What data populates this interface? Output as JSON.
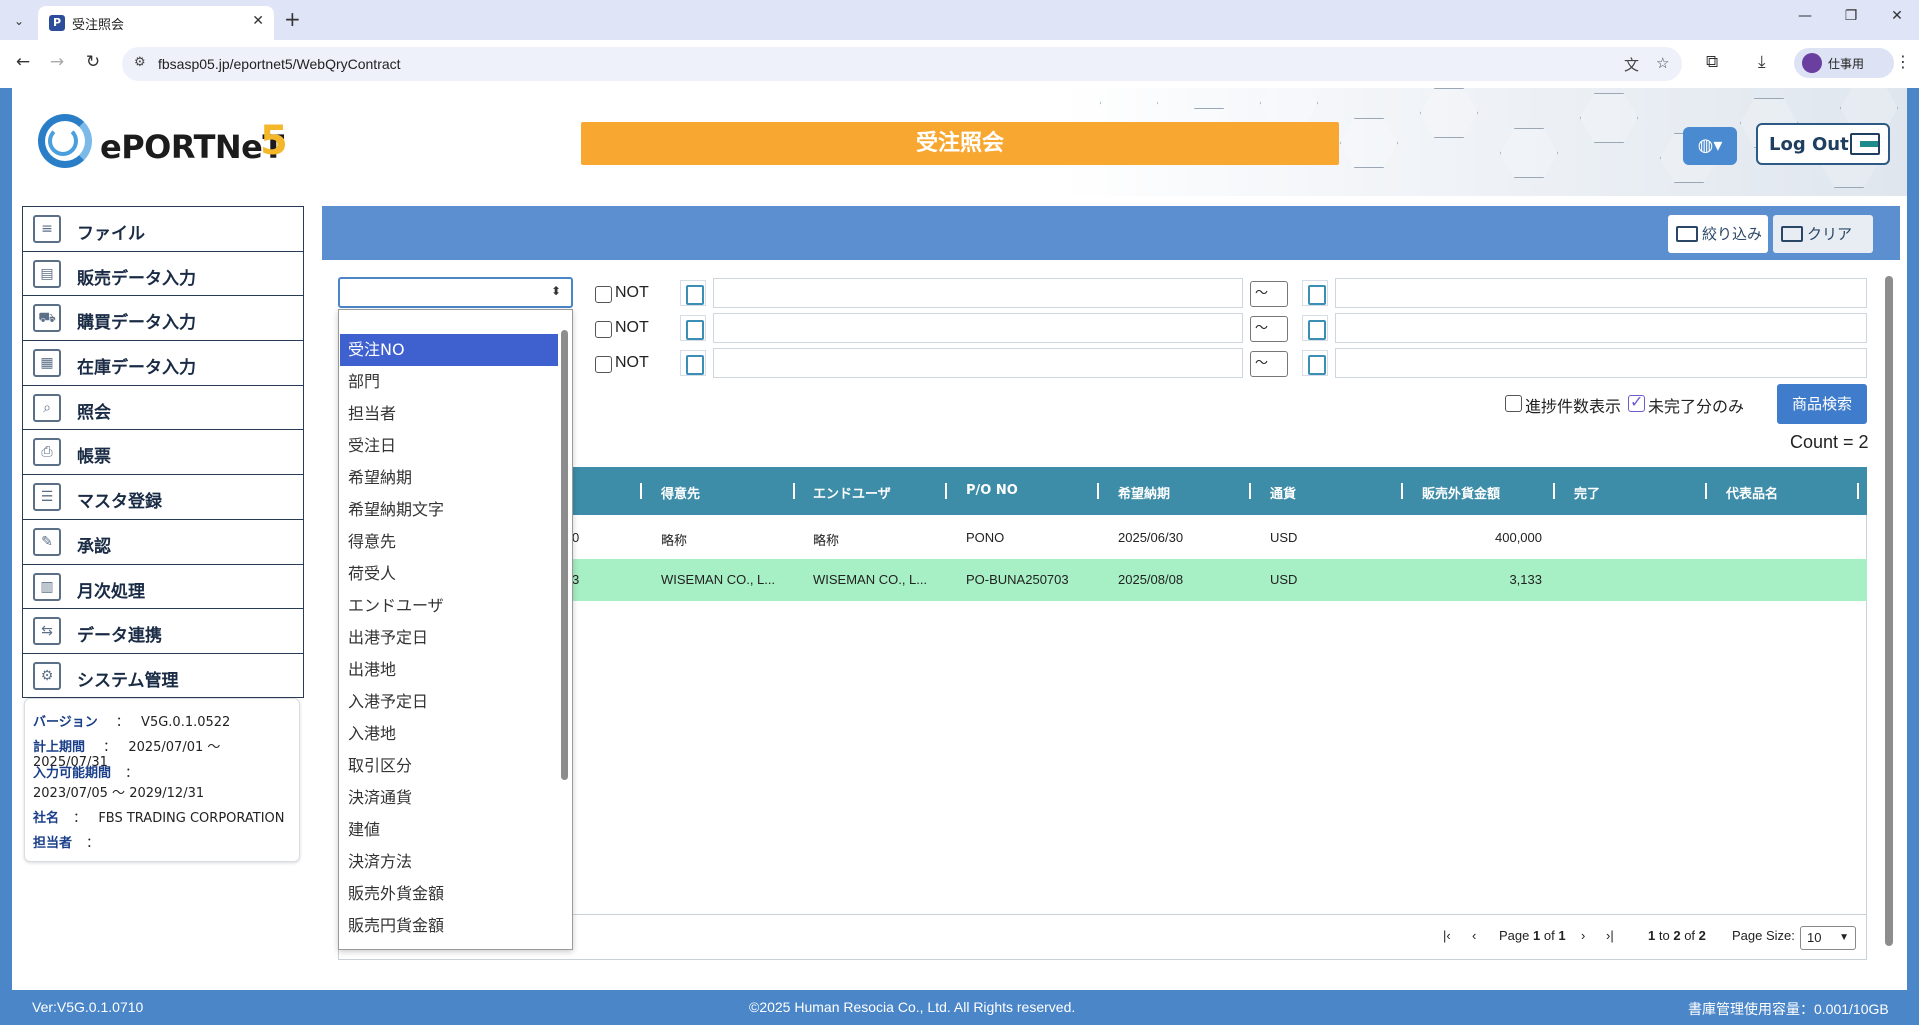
{
  "browser": {
    "tab_title": "受注照会",
    "favicon_letter": "P",
    "url": "fbsasp05.jp/eportnet5/WebQryContract",
    "profile_label": "仕事用"
  },
  "header": {
    "logo_text": "ePORTNeT",
    "logo_number": "5",
    "page_title": "受注照会",
    "logout_label": "Log Out"
  },
  "sidebar": {
    "items": [
      {
        "label": "ファイル",
        "icon": "file-icon"
      },
      {
        "label": "販売データ入力",
        "icon": "sales-input-icon"
      },
      {
        "label": "購買データ入力",
        "icon": "purchase-input-icon"
      },
      {
        "label": "在庫データ入力",
        "icon": "inventory-input-icon"
      },
      {
        "label": "照会",
        "icon": "inquiry-icon"
      },
      {
        "label": "帳票",
        "icon": "report-icon"
      },
      {
        "label": "マスタ登録",
        "icon": "master-icon"
      },
      {
        "label": "承認",
        "icon": "approval-icon"
      },
      {
        "label": "月次処理",
        "icon": "monthly-icon"
      },
      {
        "label": "データ連携",
        "icon": "data-link-icon"
      },
      {
        "label": "システム管理",
        "icon": "system-icon"
      }
    ]
  },
  "info": {
    "version_key": "バージョン",
    "version_value": "V5G.0.1.0522",
    "period_key": "計上期間",
    "period_value": "2025/07/01 〜 2025/07/31",
    "input_period_key": "入力可能期間",
    "input_period_value": "2023/07/05 〜 2029/12/31",
    "company_key": "社名",
    "company_value": "FBS TRADING CORPORATION",
    "person_key": "担当者",
    "colon": "："
  },
  "toolbar": {
    "filter_label": "絞り込み",
    "clear_label": "クリア"
  },
  "conditions": {
    "not_label": "NOT",
    "range_symbol": "〜"
  },
  "options": {
    "progress_count_label": "進捗件数表示",
    "progress_count_checked": false,
    "incomplete_only_label": "未完了分のみ",
    "incomplete_only_checked": true,
    "product_search_label": "商品検索",
    "count_text": "Count = 2"
  },
  "grid": {
    "columns": [
      "得意先",
      "エンドユーザ",
      "P/O NO",
      "希望納期",
      "通貨",
      "販売外貨金額",
      "完了",
      "代表品名"
    ],
    "rows": [
      {
        "order_suffix": "0",
        "customer": "略称",
        "end_user": "略称",
        "po_no": "PONO",
        "due_date": "2025/06/30",
        "currency": "USD",
        "amount": "400,000",
        "done": "",
        "product": ""
      },
      {
        "order_suffix": "3",
        "customer": "WISEMAN CO., L...",
        "end_user": "WISEMAN CO., L...",
        "po_no": "PO-BUNA250703",
        "due_date": "2025/08/08",
        "currency": "USD",
        "amount": "3,133",
        "done": "",
        "product": ""
      }
    ]
  },
  "pager": {
    "page_word": "Page",
    "page_current": "1",
    "of_word": "of",
    "page_total": "1",
    "range_from": "1",
    "to_word": "to",
    "range_to": "2",
    "of_word2": "of",
    "total": "2",
    "page_size_label": "Page Size:",
    "page_size_value": "10"
  },
  "dropdown": {
    "items": [
      "",
      "受注NO",
      "部門",
      "担当者",
      "受注日",
      "希望納期",
      "希望納期文字",
      "得意先",
      "荷受人",
      "エンドユーザ",
      "出港予定日",
      "出港地",
      "入港予定日",
      "入港地",
      "取引区分",
      "決済通貨",
      "建値",
      "決済方法",
      "販売外貨金額",
      "販売円貨金額"
    ],
    "active_index": 1
  },
  "footer": {
    "version": "Ver:V5G.0.1.0710",
    "copyright": "©2025 Human Resocia Co., Ltd. All Rights reserved.",
    "storage": "書庫管理使用容量：0.001/10GB"
  },
  "colors": {
    "accent_orange": "#f8a731",
    "brand_blue": "#4a86c8",
    "grid_header": "#3d8ca8",
    "selected_row": "#a7efc4"
  }
}
